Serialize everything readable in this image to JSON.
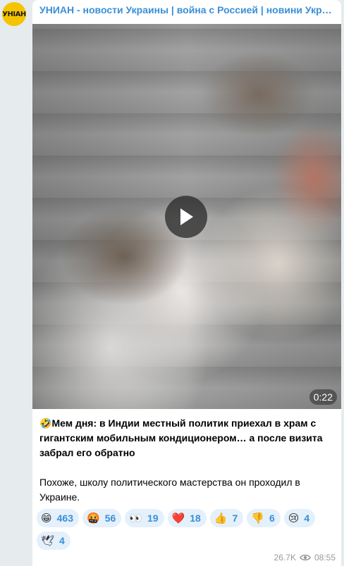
{
  "channel": {
    "avatar_text": "УНІАН",
    "title": "УНИАН - новости Украины | война с Россией | новини Україні…"
  },
  "video": {
    "duration": "0:22"
  },
  "post": {
    "emoji": "🤣",
    "headline": "Мем дня: в Индии местный политик приехал в храм с гигантским мобильным кондиционером… а после визита забрал его обратно",
    "body": "Похоже, школу политического мастерства он проходил в Украине."
  },
  "reactions": [
    {
      "emoji": "😁",
      "count": "463"
    },
    {
      "emoji": "🤬",
      "count": "56"
    },
    {
      "emoji": "👀",
      "count": "19"
    },
    {
      "emoji": "❤️",
      "count": "18"
    },
    {
      "emoji": "👍",
      "count": "7"
    },
    {
      "emoji": "👎",
      "count": "6"
    },
    {
      "emoji": "😢",
      "count": "4"
    },
    {
      "emoji": "🕊",
      "count": "4"
    }
  ],
  "meta": {
    "views": "26.7K",
    "time": "08:55"
  },
  "colors": {
    "accent": "#3a8fd6",
    "reaction_bg": "#e4f0fb",
    "avatar_bg": "#f5c400"
  }
}
